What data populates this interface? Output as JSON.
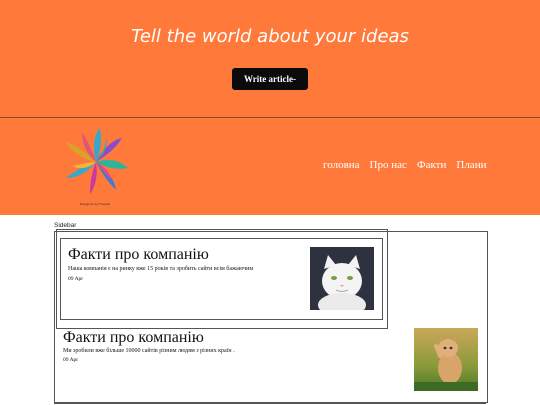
{
  "hero": {
    "tagline": "Tell the world about your ideas",
    "button_label": "Write article-"
  },
  "header": {
    "logo_icon": "flower-logo-icon",
    "logo_caption": "Designed by Freepik",
    "nav": [
      {
        "label": "головна"
      },
      {
        "label": "Про нас"
      },
      {
        "label": "Факти"
      },
      {
        "label": "Плани"
      }
    ]
  },
  "sidebar": {
    "label": "Sidebar"
  },
  "posts": [
    {
      "title": "Факти про компанію",
      "text": "Наша компанія є на ринку вже 15 років та зробить сайти всім бажаючим",
      "date": "09 Apr",
      "image_icon": "white-cat-image"
    },
    {
      "title": "Факти про компанію",
      "text": "Ми зробили вже більше 10000 сайтів різним людям з різних країн .",
      "date": "09 Apr",
      "image_icon": "kitten-image"
    }
  ],
  "colors": {
    "hero_bg": "#ff7a3a",
    "button_bg": "#0b0b0b",
    "nav_text": "#ffffff"
  }
}
